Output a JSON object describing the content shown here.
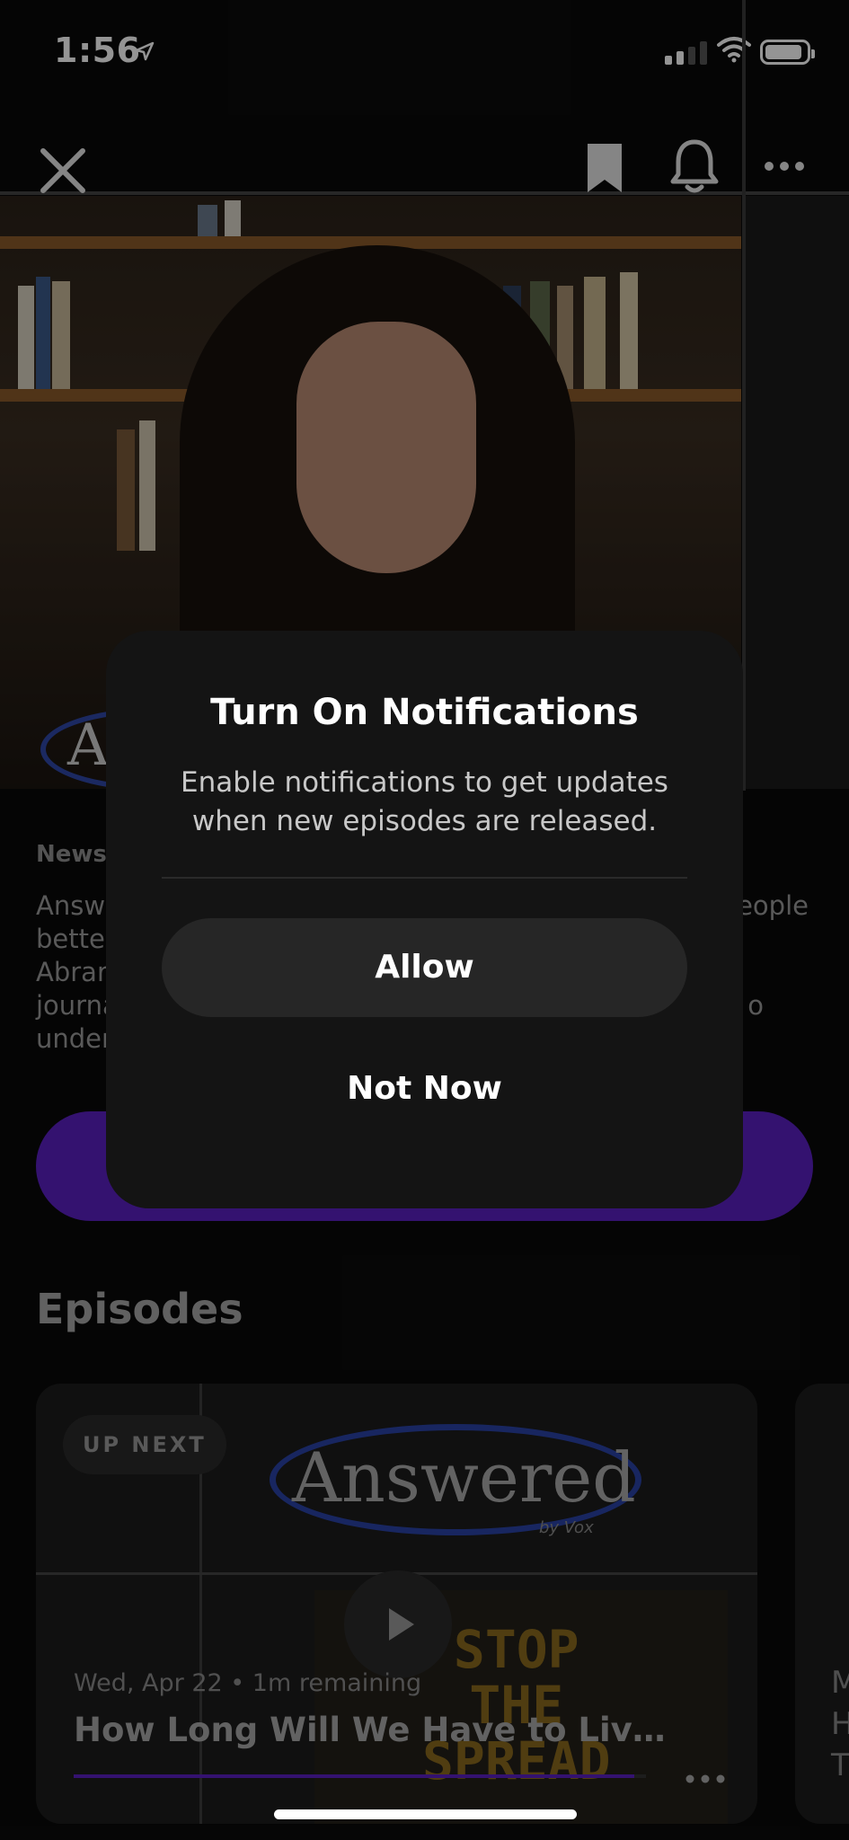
{
  "status_bar": {
    "time": "1:56"
  },
  "show": {
    "category": "News,",
    "description": "Answered helps people better understand... Abram... journalism... to understand...",
    "description_lines": [
      "Answe",
      "bette",
      "Abrar",
      "journa",
      "under"
    ],
    "description_right": [
      "eople",
      "o"
    ]
  },
  "episodes": {
    "title": "Episodes",
    "items": [
      {
        "badge": "UP NEXT",
        "logo_text": "Answered",
        "logo_by": "by Vox",
        "sign_text": "STOP\nTHE\nSPREAD",
        "meta": "Wed, Apr 22 • 1m remaining",
        "title": "How Long Will We Have to Live…",
        "progress": 0.98
      }
    ],
    "next_card_initials": [
      "M",
      "H",
      "T"
    ]
  },
  "modal": {
    "title": "Turn On Notifications",
    "message": "Enable notifications to get updates when new episodes are released.",
    "allow_label": "Allow",
    "not_now_label": "Not Now"
  },
  "colors": {
    "accent": "#5a20c2",
    "modal_bg": "#141414",
    "button_bg": "#262626"
  },
  "icons": [
    "close-icon",
    "bookmark-icon",
    "bell-icon",
    "more-icon",
    "play-icon",
    "location-arrow-icon",
    "wifi-icon",
    "battery-icon"
  ]
}
